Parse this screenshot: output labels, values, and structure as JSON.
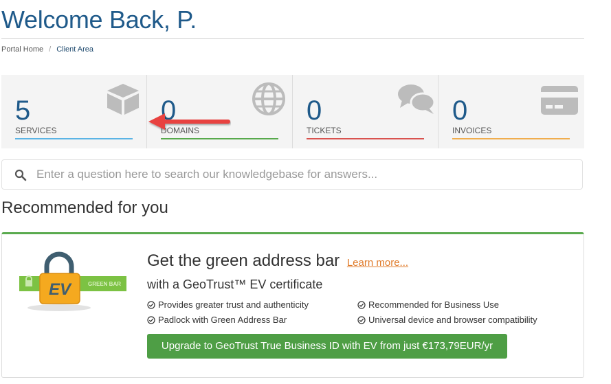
{
  "header": {
    "title": "Welcome Back, P."
  },
  "breadcrumb": {
    "home": "Portal Home",
    "separator": "/",
    "current": "Client Area"
  },
  "stats": [
    {
      "count": "5",
      "label": "SERVICES",
      "icon": "cube-icon",
      "color": "#5bb4e5"
    },
    {
      "count": "0",
      "label": "DOMAINS",
      "icon": "globe-icon",
      "color": "#57a94c"
    },
    {
      "count": "0",
      "label": "TICKETS",
      "icon": "comments-icon",
      "color": "#d9534f"
    },
    {
      "count": "0",
      "label": "INVOICES",
      "icon": "credit-card-icon",
      "color": "#f0ad4e"
    }
  ],
  "search": {
    "placeholder": "Enter a question here to search our knowledgebase for answers..."
  },
  "recommended": {
    "heading": "Recommended for you",
    "badge_text": "EV",
    "badge_tag": "GREEN BAR",
    "title": "Get the green address bar",
    "link": "Learn more...",
    "subtitle": "with a GeoTrust™ EV certificate",
    "features": [
      "Provides greater trust and authenticity",
      "Recommended for Business Use",
      "Padlock with Green Address Bar",
      "Universal device and browser compatibility"
    ],
    "button": "Upgrade to GeoTrust True Business ID with EV from just €173,79EUR/yr"
  },
  "colors": {
    "brand": "#1f5a8a",
    "accent_green": "#4e9e45",
    "link_orange": "#e07b2a",
    "arrow_red": "#e8423f"
  }
}
